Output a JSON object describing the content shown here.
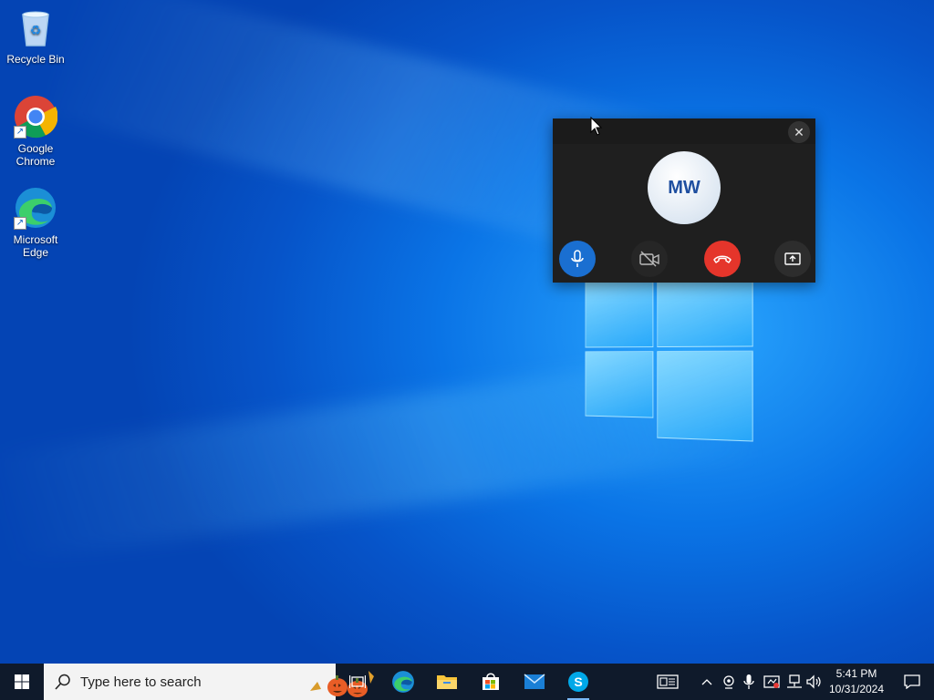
{
  "desktop": {
    "icons": [
      {
        "label": "Recycle Bin",
        "icon": "recycle-bin-icon"
      },
      {
        "label": "Google Chrome",
        "label_line1": "Google",
        "label_line2": "Chrome",
        "icon": "chrome-icon"
      },
      {
        "label": "Microsoft Edge",
        "label_line1": "Microsoft",
        "label_line2": "Edge",
        "icon": "edge-icon"
      }
    ]
  },
  "call_window": {
    "avatar_initials": "MW",
    "close_icon": "close-icon",
    "controls": [
      {
        "name": "mute-microphone",
        "icon": "microphone-icon",
        "color": "#1a6fd1"
      },
      {
        "name": "toggle-video",
        "icon": "video-off-icon",
        "color": "#262626"
      },
      {
        "name": "hang-up",
        "icon": "phone-hangup-icon",
        "color": "#e5352b"
      },
      {
        "name": "share-screen",
        "icon": "share-screen-icon",
        "color": "#2d2d2d"
      }
    ]
  },
  "taskbar": {
    "search_placeholder": "Type here to search",
    "apps": [
      {
        "name": "task-view",
        "icon": "task-view-icon"
      },
      {
        "name": "microsoft-edge",
        "icon": "edge-icon"
      },
      {
        "name": "file-explorer",
        "icon": "folder-icon"
      },
      {
        "name": "microsoft-store",
        "icon": "store-icon"
      },
      {
        "name": "mail",
        "icon": "mail-icon"
      },
      {
        "name": "skype",
        "icon": "skype-icon",
        "active": true
      }
    ],
    "tray": {
      "icons": [
        "news-icon",
        "chevron-up-icon",
        "webcam-icon",
        "microphone-icon",
        "security-icon",
        "network-icon",
        "volume-icon"
      ],
      "time": "5:41 PM",
      "date": "10/31/2024"
    }
  },
  "colors": {
    "taskbar_bg": "#0f1a2b",
    "accent_blue": "#1a6fd1",
    "hangup_red": "#e5352b"
  }
}
